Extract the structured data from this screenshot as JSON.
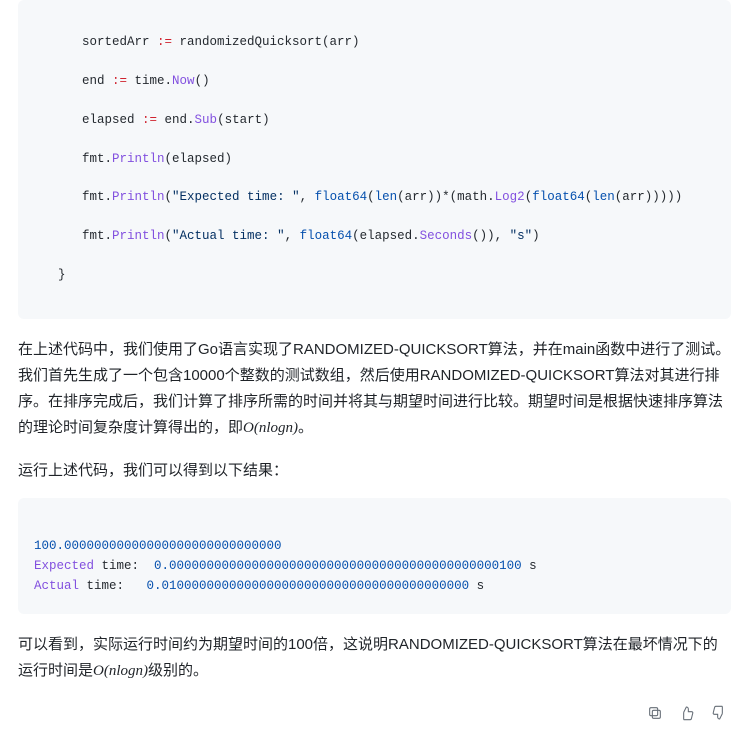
{
  "code1": {
    "l1_a": "sortedArr ",
    "l1_op": ":=",
    "l1_b": " randomizedQuicksort(arr)",
    "l2_a": "end ",
    "l2_op": ":=",
    "l2_b": " time.",
    "l2_fn": "Now",
    "l2_c": "()",
    "l3_a": "elapsed ",
    "l3_op": ":=",
    "l3_b": " end.",
    "l3_fn": "Sub",
    "l3_c": "(start)",
    "l4_a": "fmt.",
    "l4_fn": "Println",
    "l4_b": "(elapsed)",
    "l5_a": "fmt.",
    "l5_fn": "Println",
    "l5_b": "(",
    "l5_s": "\"Expected time: \"",
    "l5_c": ", ",
    "l5_f64a": "float64",
    "l5_d": "(",
    "l5_len1": "len",
    "l5_e": "(arr))*(math.",
    "l5_log": "Log2",
    "l5_f": "(",
    "l5_f64b": "float64",
    "l5_g": "(",
    "l5_len2": "len",
    "l5_h": "(arr)))))",
    "l6_a": "fmt.",
    "l6_fn": "Println",
    "l6_b": "(",
    "l6_s": "\"Actual time: \"",
    "l6_c": ", ",
    "l6_f64": "float64",
    "l6_d": "(elapsed.",
    "l6_sec": "Seconds",
    "l6_e": "()), ",
    "l6_s2": "\"s\"",
    "l6_f": ")",
    "l7": "}"
  },
  "p1": "在上述代码中，我们使用了Go语言实现了RANDOMIZED-QUICKSORT算法，并在main函数中进行了测试。我们首先生成了一个包含10000个整数的测试数组，然后使用RANDOMIZED-QUICKSORT算法对其进行排序。在排序完成后，我们计算了排序所需的时间并将其与期望时间进行比较。期望时间是根据快速排序算法的理论时间复杂度计算得出的，即",
  "math1": "O(nlogn)",
  "p1_end": "。",
  "p2": "运行上述代码，我们可以得到以下结果：",
  "output": {
    "l1_num": "100.00000000000000000000000000000",
    "l2_l1": "Expected",
    "l2_l2": " time:  ",
    "l2_v": "0.00000000000000000000000000000000000000000000100",
    "l2_u": " s",
    "l3_l1": "Actual",
    "l3_l2": " time:   ",
    "l3_v": "0.01000000000000000000000000000000000000000",
    "l3_u": " s"
  },
  "p3_a": "可以看到，实际运行时间约为期望时间的100倍，这说明RANDOMIZED-QUICKSORT算法在最坏情况下的运行时间是",
  "math2": "O(nlogn)",
  "p3_b": "级别的。",
  "icons": {
    "copy": "copy-icon",
    "up": "thumbs-up-icon",
    "down": "thumbs-down-icon"
  }
}
